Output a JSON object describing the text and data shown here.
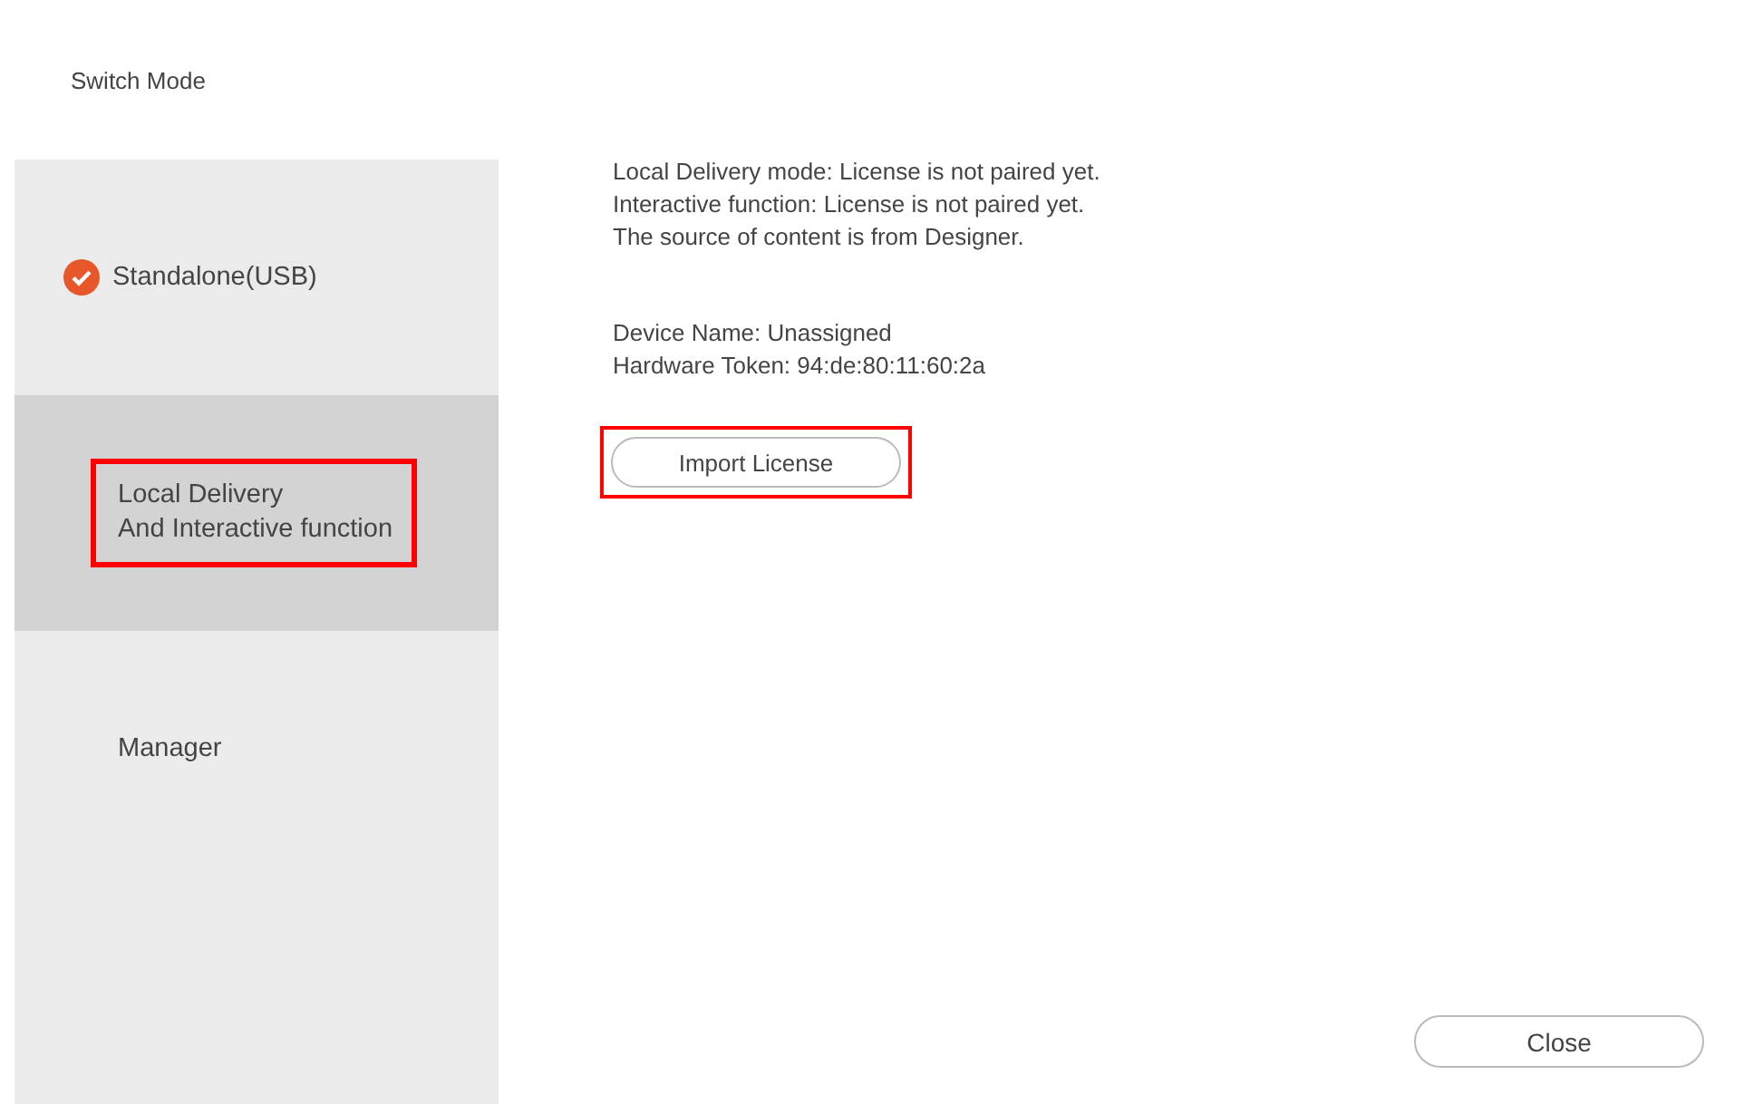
{
  "title": "Switch Mode",
  "modes": [
    {
      "lines": [
        "Standalone(USB)"
      ],
      "current": true,
      "selected": false,
      "highlighted": false
    },
    {
      "lines": [
        "Local Delivery",
        "And Interactive function"
      ],
      "current": false,
      "selected": true,
      "highlighted": true
    },
    {
      "lines": [
        "Manager"
      ],
      "current": false,
      "selected": false,
      "highlighted": false
    }
  ],
  "status_lines": [
    "Local Delivery mode: License is not paired yet.",
    "Interactive function: License is not paired yet.",
    "The source of content is from Designer."
  ],
  "device_lines": [
    "Device Name: Unassigned",
    "Hardware Token: 94:de:80:11:60:2a"
  ],
  "import_button": {
    "label": "Import License",
    "highlighted": true
  },
  "close_button": {
    "label": "Close"
  }
}
